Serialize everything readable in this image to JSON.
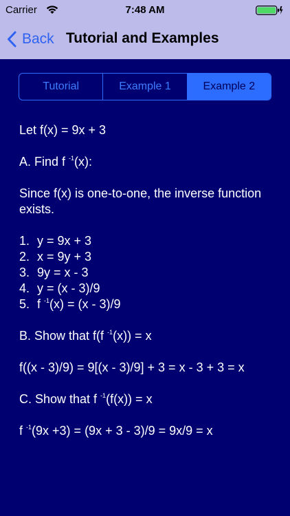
{
  "status_bar": {
    "carrier": "Carrier",
    "time": "7:48 AM",
    "battery_color": "#4cd964"
  },
  "nav": {
    "back_label": "Back",
    "title": "Tutorial and Examples"
  },
  "tabs": [
    {
      "label": "Tutorial",
      "selected": false
    },
    {
      "label": "Example 1",
      "selected": false
    },
    {
      "label": "Example 2",
      "selected": true
    }
  ],
  "content": {
    "intro": "Let f(x) = 9x + 3",
    "part_a": {
      "prefix": "A.  Find f ",
      "sup": "-1",
      "suffix": "(x):"
    },
    "explanation": "Since f(x) is one-to-one, the inverse function exists.",
    "steps": [
      {
        "num": "1.",
        "text": "y = 9x + 3"
      },
      {
        "num": "2.",
        "text": "x = 9y + 3"
      },
      {
        "num": "3.",
        "text": "9y = x - 3"
      },
      {
        "num": "4.",
        "text": "y = (x - 3)/9"
      },
      {
        "num": "5.",
        "prefix": "f ",
        "sup": "-1",
        "suffix": "(x) = (x - 3)/9"
      }
    ],
    "part_b": {
      "prefix": "B.  Show that f(f ",
      "sup": "-1",
      "suffix": "(x)) = x"
    },
    "part_b_work": "f((x - 3)/9) = 9[(x - 3)/9] + 3 = x - 3 + 3 = x",
    "part_c": {
      "prefix": "C.  Show that f ",
      "sup": "-1",
      "suffix": "(f(x)) = x"
    },
    "part_c_work": {
      "prefix": "f ",
      "sup": "-1",
      "suffix": "(9x +3) = (9x + 3 - 3)/9 = 9x/9 = x"
    }
  },
  "colors": {
    "header_bg": "#bcbbea",
    "content_bg": "#000070",
    "accent": "#2f6cff"
  }
}
